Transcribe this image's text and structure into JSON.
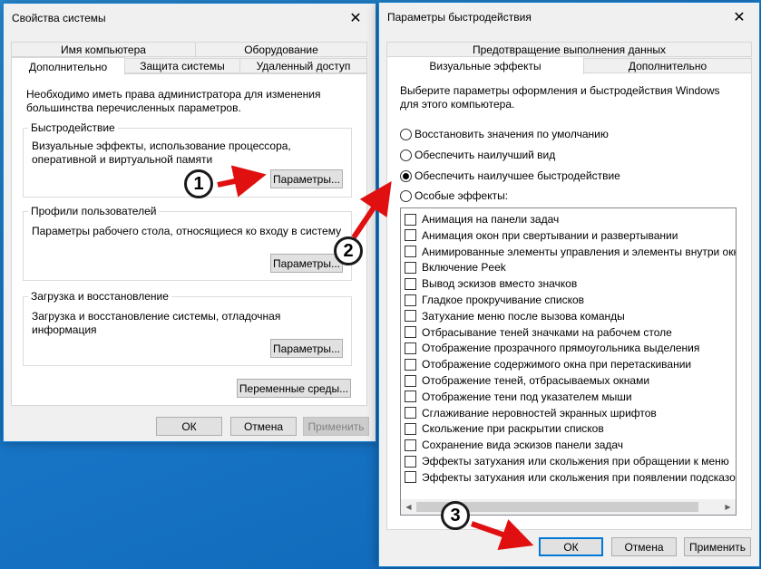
{
  "system_props": {
    "title": "Свойства системы",
    "close_glyph": "✕",
    "tabs_top": [
      "Имя компьютера",
      "Оборудование"
    ],
    "tabs_bottom": [
      "Дополнительно",
      "Защита системы",
      "Удаленный доступ"
    ],
    "admin_note": "Необходимо иметь права администратора для изменения большинства перечисленных параметров.",
    "performance": {
      "label": "Быстродействие",
      "desc": "Визуальные эффекты, использование процессора, оперативной и виртуальной памяти",
      "button": "Параметры..."
    },
    "profiles": {
      "label": "Профили пользователей",
      "desc": "Параметры рабочего стола, относящиеся ко входу в систему",
      "button": "Параметры..."
    },
    "startup": {
      "label": "Загрузка и восстановление",
      "desc": "Загрузка и восстановление системы, отладочная информация",
      "button": "Параметры..."
    },
    "env_button": "Переменные среды...",
    "ok": "ОК",
    "cancel": "Отмена",
    "apply": "Применить"
  },
  "perf_options": {
    "title": "Параметры быстродействия",
    "close_glyph": "✕",
    "tabs_top": [
      "Предотвращение выполнения данных"
    ],
    "tabs_bottom": [
      "Визуальные эффекты",
      "Дополнительно"
    ],
    "intro": "Выберите параметры оформления и быстродействия Windows для этого компьютера.",
    "radios": [
      {
        "label": "Восстановить значения по умолчанию",
        "checked": false
      },
      {
        "label": "Обеспечить наилучший вид",
        "checked": false
      },
      {
        "label": "Обеспечить наилучшее быстродействие",
        "checked": true
      },
      {
        "label": "Особые эффекты:",
        "checked": false
      }
    ],
    "effects": [
      "Анимация на панели задач",
      "Анимация окон при свертывании и развертывании",
      "Анимированные элементы управления и элементы внутри окна",
      "Включение Peek",
      "Вывод эскизов вместо значков",
      "Гладкое прокручивание списков",
      "Затухание меню после вызова команды",
      "Отбрасывание теней значками на рабочем столе",
      "Отображение прозрачного прямоугольника выделения",
      "Отображение содержимого окна при перетаскивании",
      "Отображение теней, отбрасываемых окнами",
      "Отображение тени под указателем мыши",
      "Сглаживание неровностей экранных шрифтов",
      "Скольжение при раскрытии списков",
      "Сохранение вида эскизов панели задач",
      "Эффекты затухания или скольжения при обращении к меню",
      "Эффекты затухания или скольжения при появлении подсказок"
    ],
    "scroll_left": "◀",
    "scroll_right": "▶",
    "ok": "ОК",
    "cancel": "Отмена",
    "apply": "Применить"
  },
  "annotations": {
    "step1": "1",
    "step2": "2",
    "step3": "3",
    "arrow_color": "#e01010"
  }
}
